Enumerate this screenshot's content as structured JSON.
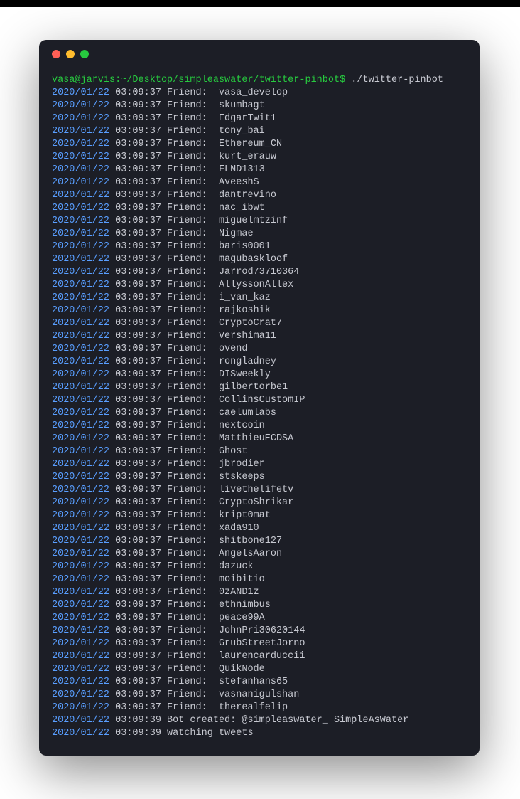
{
  "prompt": {
    "user_host": "vasa@jarvis",
    "path": "~/Desktop/simpleaswater/twitter-pinbot",
    "symbol": "$",
    "command": "./twitter-pinbot"
  },
  "entries": [
    {
      "date": "2020/01/22",
      "time": "03:09:37",
      "label": "Friend:",
      "value": "vasa_develop"
    },
    {
      "date": "2020/01/22",
      "time": "03:09:37",
      "label": "Friend:",
      "value": "skumbagt"
    },
    {
      "date": "2020/01/22",
      "time": "03:09:37",
      "label": "Friend:",
      "value": "EdgarTwit1"
    },
    {
      "date": "2020/01/22",
      "time": "03:09:37",
      "label": "Friend:",
      "value": "tony_bai"
    },
    {
      "date": "2020/01/22",
      "time": "03:09:37",
      "label": "Friend:",
      "value": "Ethereum_CN"
    },
    {
      "date": "2020/01/22",
      "time": "03:09:37",
      "label": "Friend:",
      "value": "kurt_erauw"
    },
    {
      "date": "2020/01/22",
      "time": "03:09:37",
      "label": "Friend:",
      "value": "FLND1313"
    },
    {
      "date": "2020/01/22",
      "time": "03:09:37",
      "label": "Friend:",
      "value": "AveeshS"
    },
    {
      "date": "2020/01/22",
      "time": "03:09:37",
      "label": "Friend:",
      "value": "dantrevino"
    },
    {
      "date": "2020/01/22",
      "time": "03:09:37",
      "label": "Friend:",
      "value": "nac_ibwt"
    },
    {
      "date": "2020/01/22",
      "time": "03:09:37",
      "label": "Friend:",
      "value": "miguelmtzinf"
    },
    {
      "date": "2020/01/22",
      "time": "03:09:37",
      "label": "Friend:",
      "value": "Nigmae"
    },
    {
      "date": "2020/01/22",
      "time": "03:09:37",
      "label": "Friend:",
      "value": "baris0001"
    },
    {
      "date": "2020/01/22",
      "time": "03:09:37",
      "label": "Friend:",
      "value": "magubaskloof"
    },
    {
      "date": "2020/01/22",
      "time": "03:09:37",
      "label": "Friend:",
      "value": "Jarrod73710364"
    },
    {
      "date": "2020/01/22",
      "time": "03:09:37",
      "label": "Friend:",
      "value": "AllyssonAllex"
    },
    {
      "date": "2020/01/22",
      "time": "03:09:37",
      "label": "Friend:",
      "value": "i_van_kaz"
    },
    {
      "date": "2020/01/22",
      "time": "03:09:37",
      "label": "Friend:",
      "value": "rajkoshik"
    },
    {
      "date": "2020/01/22",
      "time": "03:09:37",
      "label": "Friend:",
      "value": "CryptoCrat7"
    },
    {
      "date": "2020/01/22",
      "time": "03:09:37",
      "label": "Friend:",
      "value": "Vershima11"
    },
    {
      "date": "2020/01/22",
      "time": "03:09:37",
      "label": "Friend:",
      "value": "ovend"
    },
    {
      "date": "2020/01/22",
      "time": "03:09:37",
      "label": "Friend:",
      "value": "rongladney"
    },
    {
      "date": "2020/01/22",
      "time": "03:09:37",
      "label": "Friend:",
      "value": "DISweekly"
    },
    {
      "date": "2020/01/22",
      "time": "03:09:37",
      "label": "Friend:",
      "value": "gilbertorbe1"
    },
    {
      "date": "2020/01/22",
      "time": "03:09:37",
      "label": "Friend:",
      "value": "CollinsCustomIP"
    },
    {
      "date": "2020/01/22",
      "time": "03:09:37",
      "label": "Friend:",
      "value": "caelumlabs"
    },
    {
      "date": "2020/01/22",
      "time": "03:09:37",
      "label": "Friend:",
      "value": "nextcoin"
    },
    {
      "date": "2020/01/22",
      "time": "03:09:37",
      "label": "Friend:",
      "value": "MatthieuECDSA"
    },
    {
      "date": "2020/01/22",
      "time": "03:09:37",
      "label": "Friend:",
      "value": "Ghost"
    },
    {
      "date": "2020/01/22",
      "time": "03:09:37",
      "label": "Friend:",
      "value": "jbrodier"
    },
    {
      "date": "2020/01/22",
      "time": "03:09:37",
      "label": "Friend:",
      "value": "stskeeps"
    },
    {
      "date": "2020/01/22",
      "time": "03:09:37",
      "label": "Friend:",
      "value": "livethelifetv"
    },
    {
      "date": "2020/01/22",
      "time": "03:09:37",
      "label": "Friend:",
      "value": "CryptoShrikar"
    },
    {
      "date": "2020/01/22",
      "time": "03:09:37",
      "label": "Friend:",
      "value": "kript0mat"
    },
    {
      "date": "2020/01/22",
      "time": "03:09:37",
      "label": "Friend:",
      "value": "xada910"
    },
    {
      "date": "2020/01/22",
      "time": "03:09:37",
      "label": "Friend:",
      "value": "shitbone127"
    },
    {
      "date": "2020/01/22",
      "time": "03:09:37",
      "label": "Friend:",
      "value": "AngelsAaron"
    },
    {
      "date": "2020/01/22",
      "time": "03:09:37",
      "label": "Friend:",
      "value": "dazuck"
    },
    {
      "date": "2020/01/22",
      "time": "03:09:37",
      "label": "Friend:",
      "value": "moibitio"
    },
    {
      "date": "2020/01/22",
      "time": "03:09:37",
      "label": "Friend:",
      "value": "0zAND1z"
    },
    {
      "date": "2020/01/22",
      "time": "03:09:37",
      "label": "Friend:",
      "value": "ethnimbus"
    },
    {
      "date": "2020/01/22",
      "time": "03:09:37",
      "label": "Friend:",
      "value": "peace99A"
    },
    {
      "date": "2020/01/22",
      "time": "03:09:37",
      "label": "Friend:",
      "value": "JohnPri30620144"
    },
    {
      "date": "2020/01/22",
      "time": "03:09:37",
      "label": "Friend:",
      "value": "GrubStreetJorno"
    },
    {
      "date": "2020/01/22",
      "time": "03:09:37",
      "label": "Friend:",
      "value": "laurencarduccii"
    },
    {
      "date": "2020/01/22",
      "time": "03:09:37",
      "label": "Friend:",
      "value": "QuikNode"
    },
    {
      "date": "2020/01/22",
      "time": "03:09:37",
      "label": "Friend:",
      "value": "stefanhans65"
    },
    {
      "date": "2020/01/22",
      "time": "03:09:37",
      "label": "Friend:",
      "value": "vasnanigulshan"
    },
    {
      "date": "2020/01/22",
      "time": "03:09:37",
      "label": "Friend:",
      "value": "therealfelip"
    },
    {
      "date": "2020/01/22",
      "time": "03:09:39",
      "label": "Bot created:",
      "value": "@simpleaswater_ SimpleAsWater"
    },
    {
      "date": "2020/01/22",
      "time": "03:09:39",
      "label": "watching tweets",
      "value": ""
    }
  ]
}
